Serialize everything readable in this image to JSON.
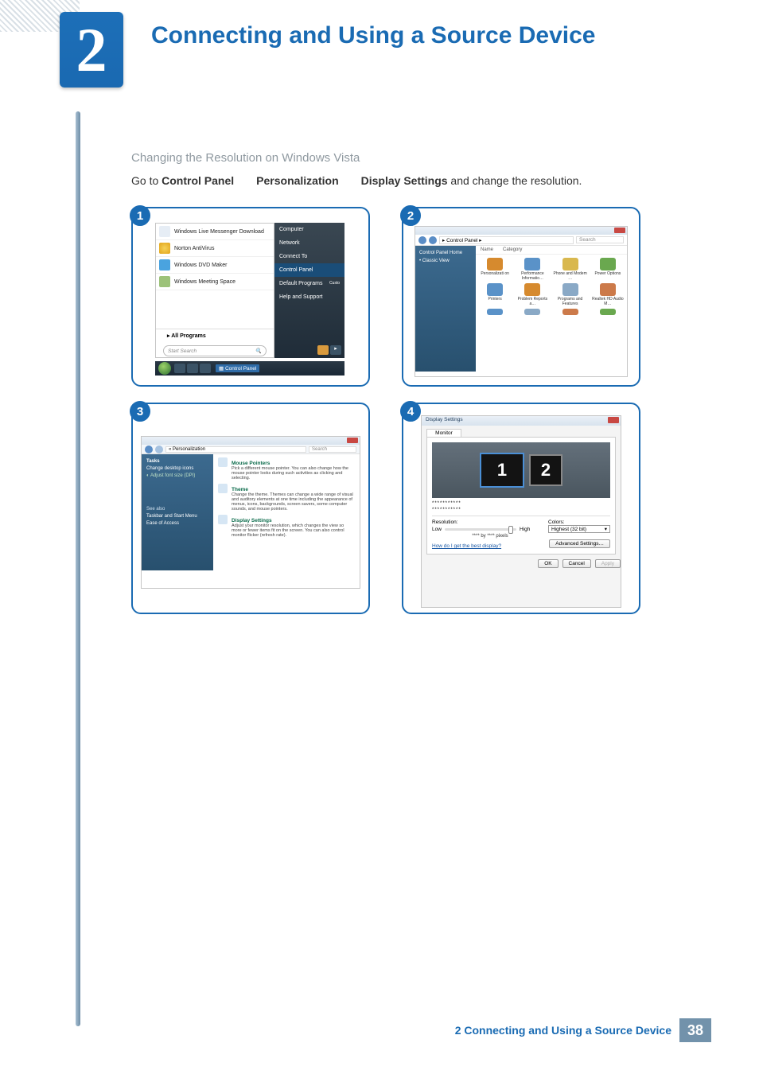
{
  "chapter": {
    "number": "2",
    "title": "Connecting and Using a Source Device"
  },
  "subheading": "Changing the Resolution on Windows Vista",
  "instruction": {
    "prefix": "Go to ",
    "b1": "Control Panel",
    "b2": "Personalization",
    "b3": "Display Settings",
    "suffix": " and change the resolution."
  },
  "steps": {
    "s1": "1",
    "s2": "2",
    "s3": "3",
    "s4": "4"
  },
  "panel1": {
    "left": {
      "items": [
        "Windows Live Messenger Download",
        "Norton AntiVirus",
        "Windows DVD Maker",
        "Windows Meeting Space"
      ],
      "allPrograms": "All Programs",
      "search": "Start Search"
    },
    "right": [
      "Computer",
      "Network",
      "Connect To",
      "Control Panel",
      "Default Programs",
      "Help and Support"
    ],
    "defaultProgramsNote": "Custo",
    "taskbarLabel": "Control Panel"
  },
  "panel2": {
    "breadcrumb": "▸ Control Panel ▸",
    "search": "Search",
    "headers": [
      "Name",
      "Category"
    ],
    "side": [
      "Control Panel Home",
      "• Classic View"
    ],
    "icons": [
      {
        "label": "Personalizati on",
        "color": "#d68a2e"
      },
      {
        "label": "Performance Informatio…",
        "color": "#5a92c8"
      },
      {
        "label": "Phone and Modem …",
        "color": "#d9b84e"
      },
      {
        "label": "Power Options",
        "color": "#6aa84f"
      },
      {
        "label": "Printers",
        "color": "#5a92c8"
      },
      {
        "label": "Problem Reports a…",
        "color": "#d68a2e"
      },
      {
        "label": "Programs and Features",
        "color": "#8aa9c6"
      },
      {
        "label": "Realtek HD Audio M…",
        "color": "#cc7a4a"
      }
    ]
  },
  "panel3": {
    "breadcrumb": "« Personalization",
    "search": "Search",
    "side": {
      "hdr": "Tasks",
      "items": [
        "Change desktop icons",
        "Adjust font size (DPI)"
      ],
      "seeAlso": "See also",
      "more": [
        "Taskbar and Start Menu",
        "Ease of Access"
      ]
    },
    "main": [
      {
        "title": "Mouse Pointers",
        "body": "Pick a different mouse pointer. You can also change how the mouse pointer looks during such activities as clicking and selecting."
      },
      {
        "title": "Theme",
        "body": "Change the theme. Themes can change a wide range of visual and auditory elements at one time including the appearance of menus, icons, backgrounds, screen savers, some computer sounds, and mouse pointers."
      },
      {
        "title": "Display Settings",
        "body": "Adjust your monitor resolution, which changes the view so more or fewer items fit on the screen. You can also control monitor flicker (refresh rate)."
      }
    ]
  },
  "panel4": {
    "title": "Display Settings",
    "tab": "Monitor",
    "mon1": "1",
    "mon2": "2",
    "stars1": "***********",
    "stars2": "***********",
    "resolution": "Resolution:",
    "low": "Low",
    "high": "High",
    "pixels": "**** by **** pixels",
    "colors": "Colors:",
    "colorVal": "Highest (32 bit)",
    "helpLink": "How do I get the best display?",
    "adv": "Advanced Settings…",
    "ok": "OK",
    "cancel": "Cancel",
    "apply": "Apply"
  },
  "footer": {
    "text": "2 Connecting and Using a Source Device",
    "page": "38"
  }
}
